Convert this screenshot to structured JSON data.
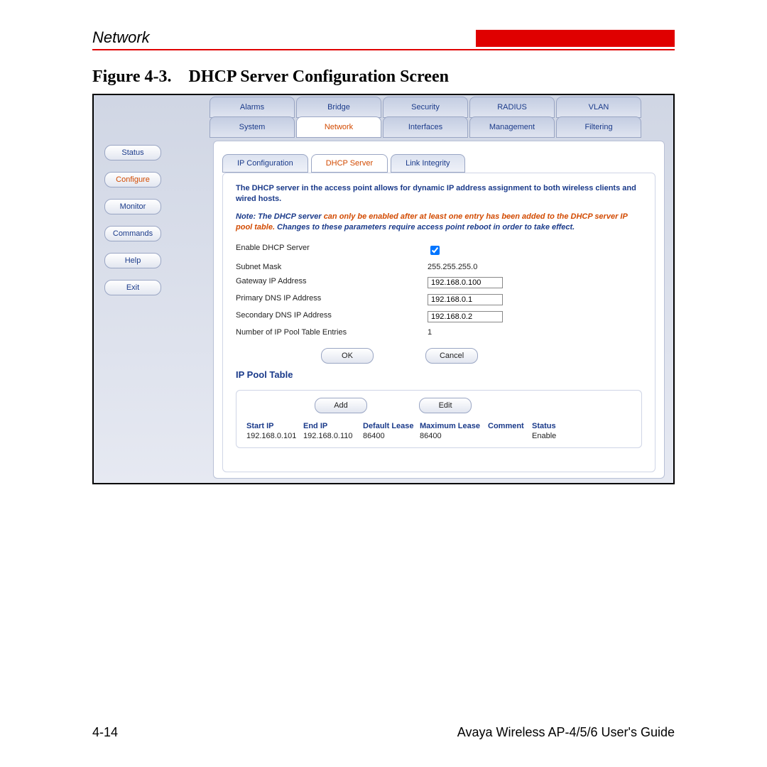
{
  "header": {
    "section": "Network"
  },
  "figure": {
    "label": "Figure 4-3.",
    "title": "DHCP Server Configuration Screen"
  },
  "sidebar": {
    "items": [
      "Status",
      "Configure",
      "Monitor",
      "Commands",
      "Help",
      "Exit"
    ],
    "active": 1
  },
  "topTabs": {
    "row1": [
      "Alarms",
      "Bridge",
      "Security",
      "RADIUS",
      "VLAN"
    ],
    "row2": [
      "System",
      "Network",
      "Interfaces",
      "Management",
      "Filtering"
    ],
    "active": 1
  },
  "subTabs": {
    "items": [
      "IP Configuration",
      "DHCP Server",
      "Link Integrity"
    ],
    "active": 1
  },
  "text": {
    "desc": "The DHCP server in the access point allows for dynamic IP address assignment to both wireless clients and wired hosts.",
    "noteLead": "Note: The DHCP server ",
    "noteOrange": "can only be enabled after at least one entry has been added to the DHCP server IP pool table.",
    "noteTail": " Changes to these parameters require access point reboot in order to take effect."
  },
  "form": {
    "fields": [
      {
        "label": "Enable DHCP Server",
        "type": "checkbox",
        "value": true
      },
      {
        "label": "Subnet Mask",
        "type": "static",
        "value": "255.255.255.0"
      },
      {
        "label": "Gateway IP Address",
        "type": "text",
        "value": "192.168.0.100"
      },
      {
        "label": "Primary DNS IP Address",
        "type": "text",
        "value": "192.168.0.1"
      },
      {
        "label": "Secondary DNS IP Address",
        "type": "text",
        "value": "192.168.0.2"
      },
      {
        "label": "Number of IP Pool Table Entries",
        "type": "static",
        "value": "1"
      }
    ],
    "buttons": {
      "ok": "OK",
      "cancel": "Cancel"
    }
  },
  "pool": {
    "title": "IP Pool Table",
    "buttons": {
      "add": "Add",
      "edit": "Edit"
    },
    "headers": [
      "Start IP",
      "End IP",
      "Default Lease",
      "Maximum Lease",
      "Comment",
      "Status"
    ],
    "rows": [
      [
        "192.168.0.101",
        "192.168.0.110",
        "86400",
        "86400",
        "",
        "Enable"
      ]
    ]
  },
  "footer": {
    "page": "4-14",
    "guide": "Avaya Wireless AP-4/5/6 User's Guide"
  }
}
